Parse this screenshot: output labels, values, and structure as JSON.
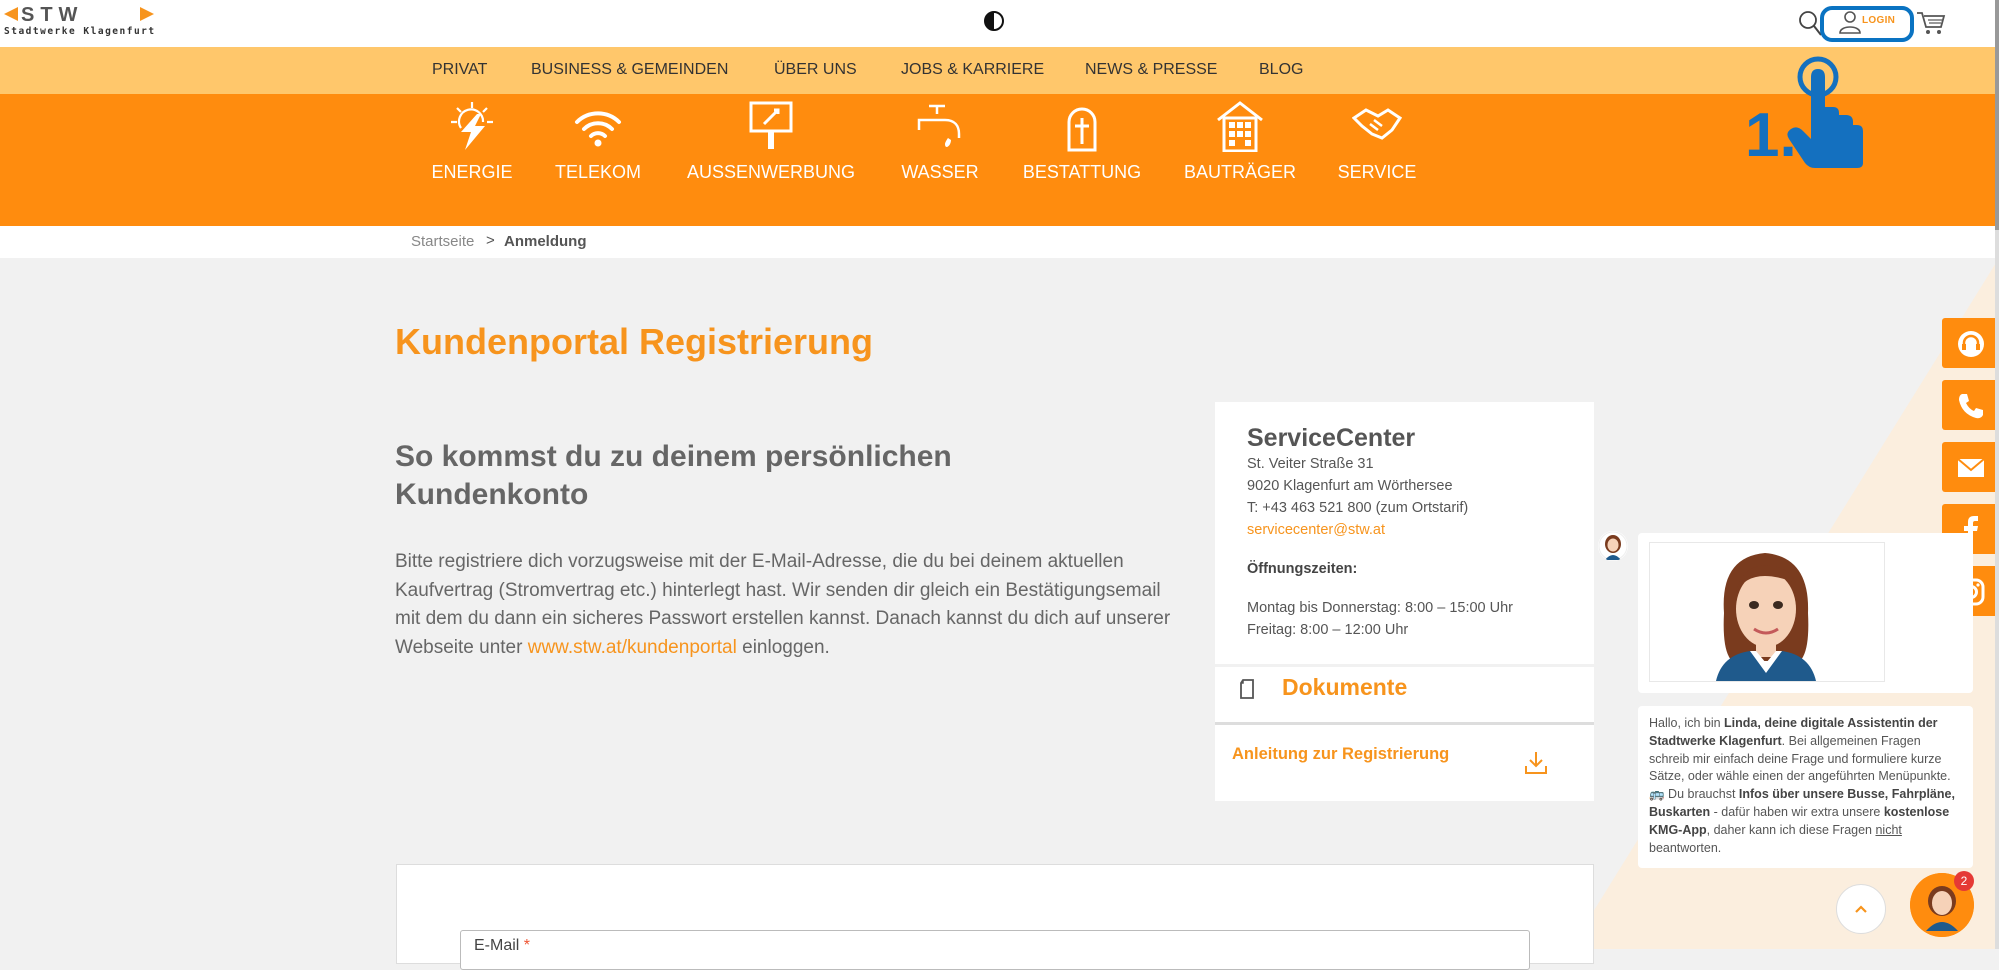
{
  "brand": {
    "logo_text": "STW",
    "logo_subtitle": "Stadtwerke Klagenfurt",
    "accent": "#f7941d",
    "orange": "#ff8c0e",
    "nav_bg": "#ffc76b",
    "highlight": "#0a73c2"
  },
  "header": {
    "login_label": "LOGIN",
    "icons": [
      "contrast-icon",
      "search-icon",
      "user-icon",
      "cart-icon"
    ]
  },
  "nav": {
    "items": [
      "PRIVAT",
      "BUSINESS & GEMEINDEN",
      "ÜBER UNS",
      "JOBS & KARRIERE",
      "NEWS & PRESSE",
      "BLOG"
    ]
  },
  "categories": [
    {
      "label": "ENERGIE",
      "icon": "lightning-icon"
    },
    {
      "label": "TELEKOM",
      "icon": "wifi-icon"
    },
    {
      "label": "AUSSENWERBUNG",
      "icon": "billboard-icon"
    },
    {
      "label": "WASSER",
      "icon": "faucet-icon"
    },
    {
      "label": "BESTATTUNG",
      "icon": "cross-icon"
    },
    {
      "label": "BAUTRÄGER",
      "icon": "building-icon"
    },
    {
      "label": "SERVICE",
      "icon": "handshake-icon"
    }
  ],
  "breadcrumb": {
    "home": "Startseite",
    "separator": ">",
    "current": "Anmeldung"
  },
  "page": {
    "title": "Kundenportal Registrierung",
    "subtitle": "So kommst du zu deinem persönlichen Kundenkonto",
    "intro_before": "Bitte registriere dich vorzugsweise mit der E-Mail-Adresse, die du bei deinem aktuellen Kaufvertrag (Stromvertrag etc.) hinterlegt hast. Wir senden dir gleich ein Bestätigungsemail mit dem du dann ein sicheres Passwort erstellen kannst. Danach kannst du dich auf unserer Webseite unter ",
    "intro_link": "www.stw.at/kundenportal",
    "intro_after": " einloggen."
  },
  "service_center": {
    "title": "ServiceCenter",
    "street": "St. Veiter Straße 31",
    "city": "9020 Klagenfurt am Wörthersee",
    "phone": "T: +43 463 521 800 (zum Ortstarif)",
    "email": "servicecenter@stw.at",
    "hours_title": "Öffnungszeiten:",
    "hours_1": "Montag bis Donnerstag: 8:00 – 15:00 Uhr",
    "hours_2": "Freitag: 8:00 – 12:00 Uhr"
  },
  "documents": {
    "title": "Dokumente",
    "items": [
      {
        "label": "Anleitung zur Registrierung",
        "icon": "download-icon"
      }
    ]
  },
  "form": {
    "email_label": "E-Mail",
    "required_mark": "*"
  },
  "side_buttons": [
    "headset-icon",
    "phone-icon",
    "mail-icon",
    "facebook-icon",
    "instagram-icon"
  ],
  "chat": {
    "p1": "Hallo, ich bin ",
    "name": "Linda",
    "p2": ", deine digitale Assistentin der Stadtwerke Klagenfurt",
    "p3": ". Bei allgemeinen Fragen schreib mir einfach deine Frage und formuliere kurze Sätze, oder wähle einen der angeführten Menüpunkte. 🚌 Du brauchst ",
    "b2": "Infos über unsere Busse, Fahrpläne, Buskarten",
    "p4": " - dafür haben wir extra unsere ",
    "b3": "kostenlose KMG-App",
    "p5": ", daher kann ich diese Fragen ",
    "u1": "nicht ",
    "p6": "beantworten.",
    "badge": "2"
  },
  "tutorial": {
    "step_label": "1."
  }
}
